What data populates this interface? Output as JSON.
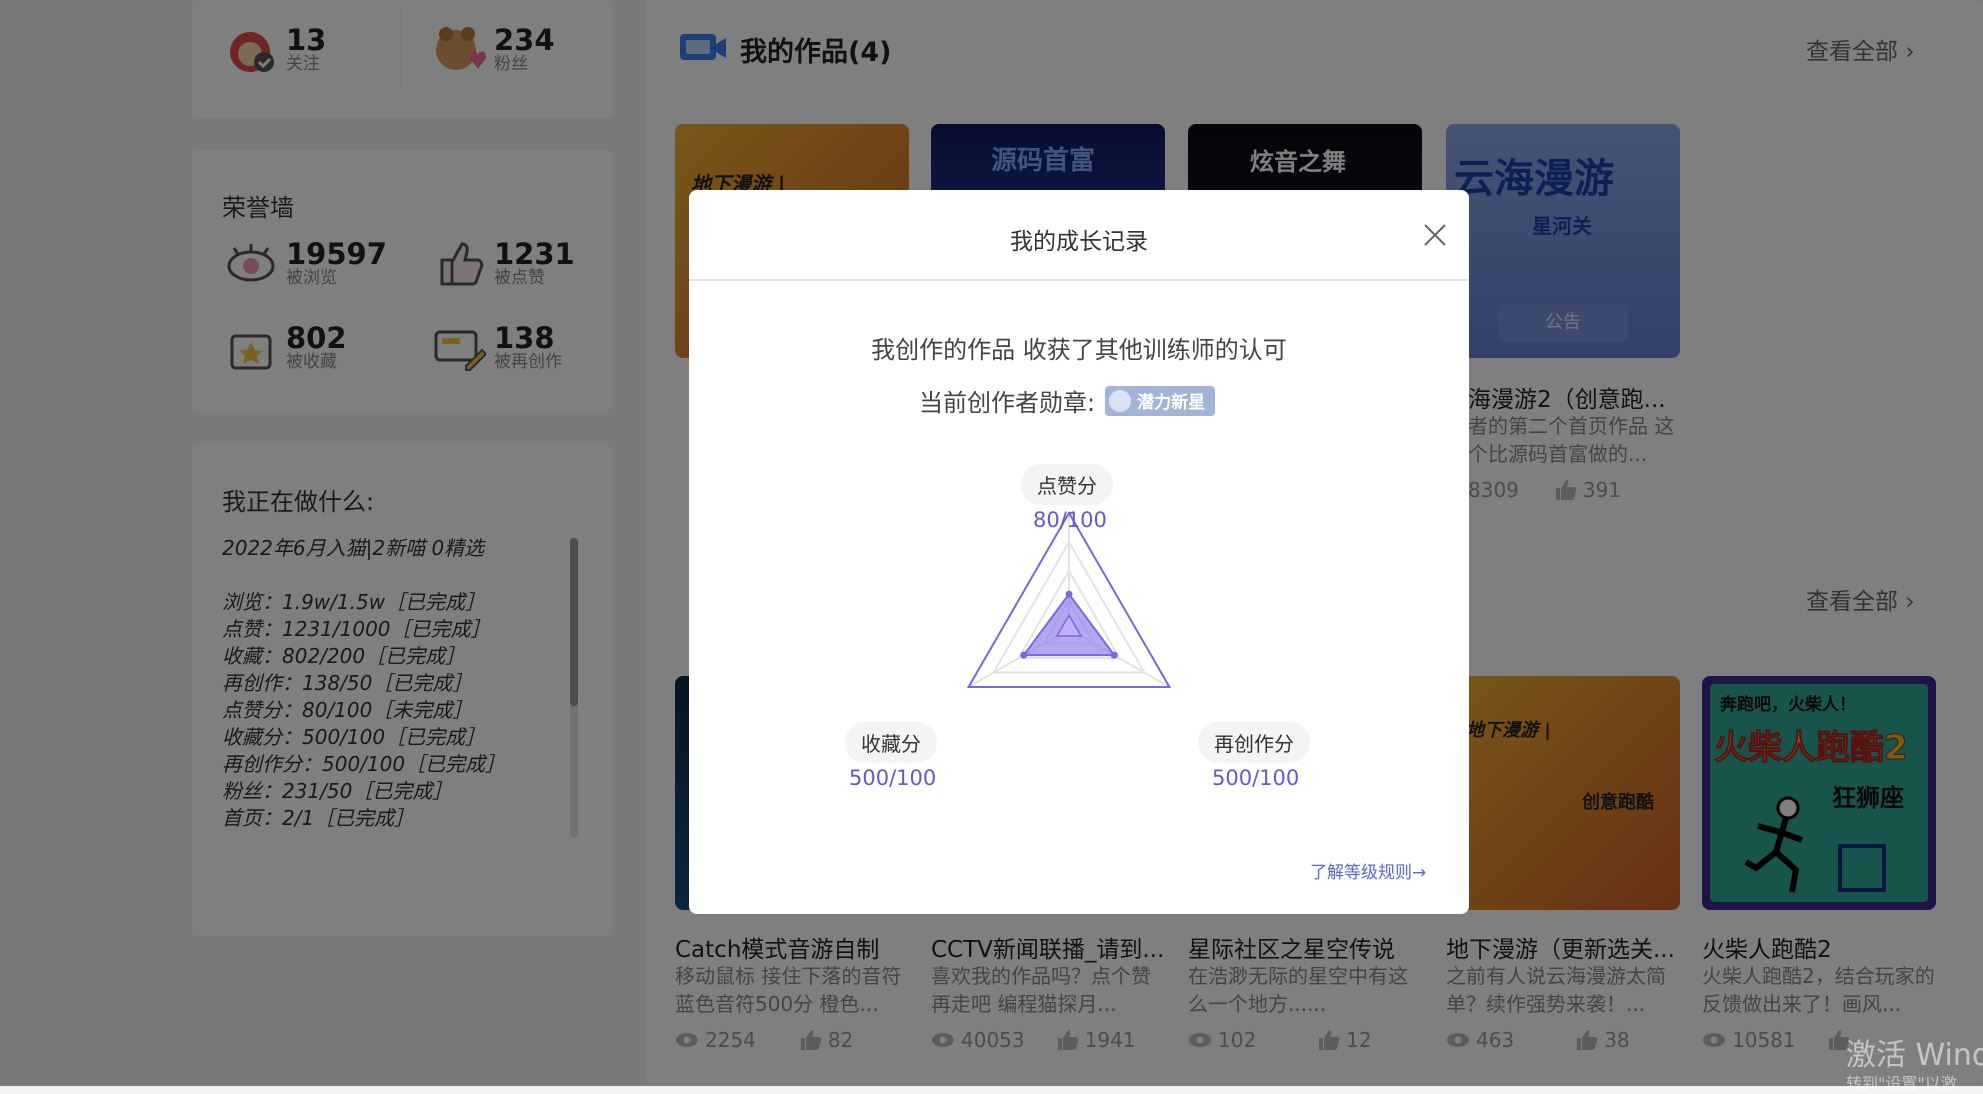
{
  "profile_stats": {
    "follow_count": "13",
    "follow_label": "关注",
    "fans_count": "234",
    "fans_label": "粉丝"
  },
  "honor_wall": {
    "title": "荣誉墙",
    "items": [
      {
        "value": "19597",
        "label": "被浏览"
      },
      {
        "value": "1231",
        "label": "被点赞"
      },
      {
        "value": "802",
        "label": "被收藏"
      },
      {
        "value": "138",
        "label": "被再创作"
      }
    ]
  },
  "doing": {
    "title": "我正在做什么:",
    "lines": [
      "2022年6月入猫|2新喵 0精选",
      "",
      "浏览：1.9w/1.5w［已完成］",
      "点赞：1231/1000［已完成］",
      "收藏：802/200［已完成］",
      "再创作：138/50［已完成］",
      "点赞分：80/100［未完成］",
      "收藏分：500/100［已完成］",
      "再创作分：500/100［已完成］",
      "粉丝：231/50［已完成］",
      "首页：2/1［已完成］"
    ]
  },
  "works_section": {
    "title": "我的作品(4)",
    "view_all": "查看全部",
    "top_cards": [
      {
        "thumb_text": "地下漫游 |",
        "color1": "#e8a23a",
        "color2": "#c9602a"
      },
      {
        "thumb_text": "源码首富",
        "color1": "#1a1f6e",
        "color2": "#3d6bd8"
      },
      {
        "thumb_text": "炫音之舞",
        "color1": "#101018",
        "color2": "#2a1a40"
      },
      {
        "thumb_text": "云海漫游",
        "sub_text": "星河关",
        "button_text": "公告",
        "title": "海漫游2（创意跑...",
        "desc": "者的第二个首页作品 这个比源码首富做的...",
        "views": "8309",
        "likes": "391",
        "color1": "#8fa6e8",
        "color2": "#6a7fd6"
      }
    ]
  },
  "second_section": {
    "view_all": "查看全部",
    "cards": [
      {
        "title": "Catch模式音游自制",
        "desc": "移动鼠标 接住下落的音符 蓝色音符500分 橙色...",
        "views": "2254",
        "likes": "82",
        "color1": "#0d2a44",
        "color2": "#1a4d78"
      },
      {
        "title": "CCTV新闻联播_请到...",
        "desc": "喜欢我的作品吗？点个赞再走吧      编程猫探月...",
        "views": "40053",
        "likes": "1941",
        "color1": "#1b3f8a",
        "color2": "#3a6bd0"
      },
      {
        "title": "星际社区之星空传说",
        "desc": "在浩渺无际的星空中有这么一个地方......",
        "views": "102",
        "likes": "12",
        "color1": "#10102a",
        "color2": "#26265a"
      },
      {
        "title": "地下漫游（更新选关...",
        "desc": "之前有人说云海漫游太简单？续作强势来袭！...",
        "views": "463",
        "likes": "38",
        "thumb_text": "地下漫游 |",
        "thumb_sub": "创意跑酷",
        "color1": "#e8a23a",
        "color2": "#c9602a"
      },
      {
        "title": "火柴人跑酷2",
        "desc": "火柴人跑酷2，结合玩家的反馈做出来了！画风...",
        "views": "10581",
        "likes": "",
        "thumb_text": "奔跑吧，火柴人！",
        "thumb_big": "火柴人跑酷2",
        "thumb_sub": "狂狮座",
        "color1": "#2a9a8e",
        "color2": "#3ab0a0"
      }
    ]
  },
  "watermark": {
    "line1": "激活 Wind",
    "line2": "转到\"设置\"以激"
  },
  "modal": {
    "title": "我的成长记录",
    "subtitle": "我创作的作品 收获了其他训练师的认可",
    "badge_label": "当前创作者勋章:",
    "badge_text": "潜力新星",
    "rules_link": "了解等级规则→",
    "radar": {
      "axes": [
        {
          "name": "点赞分",
          "score": "80/100",
          "value": 80,
          "max": 100
        },
        {
          "name": "收藏分",
          "score": "500/100",
          "value": 500,
          "max": 100
        },
        {
          "name": "再创作分",
          "score": "500/100",
          "value": 500,
          "max": 100
        }
      ],
      "accent": "#7a66e0"
    }
  }
}
